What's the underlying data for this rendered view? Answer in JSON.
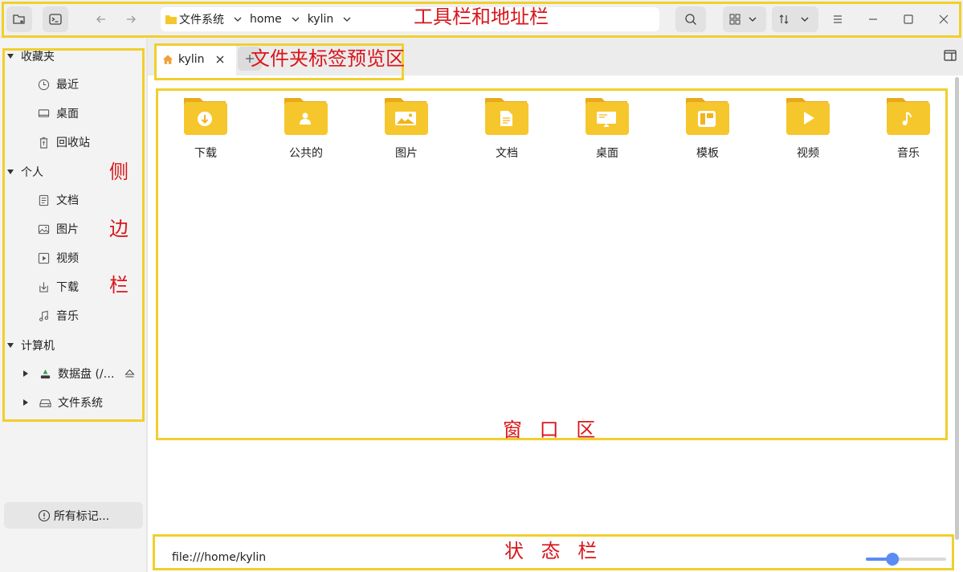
{
  "toolbar": {
    "breadcrumbs": [
      "文件系统",
      "home",
      "kylin"
    ]
  },
  "sidebar": {
    "sections": [
      {
        "label": "收藏夹",
        "items": [
          {
            "label": "最近",
            "icon": "clock-icon"
          },
          {
            "label": "桌面",
            "icon": "monitor-icon"
          },
          {
            "label": "回收站",
            "icon": "trash-icon"
          }
        ]
      },
      {
        "label": "个人",
        "items": [
          {
            "label": "文档",
            "icon": "document-icon"
          },
          {
            "label": "图片",
            "icon": "image-icon"
          },
          {
            "label": "视频",
            "icon": "video-icon"
          },
          {
            "label": "下载",
            "icon": "download-icon"
          },
          {
            "label": "音乐",
            "icon": "music-icon"
          }
        ]
      },
      {
        "label": "计算机",
        "items": [
          {
            "label": "数据盘 (/…",
            "icon": "drive-icon"
          },
          {
            "label": "文件系统",
            "icon": "hdd-icon"
          }
        ]
      }
    ],
    "tags_button": "所有标记..."
  },
  "tabs": [
    {
      "label": "kylin"
    }
  ],
  "files": [
    {
      "name": "下载",
      "icon": "download-folder-icon"
    },
    {
      "name": "公共的",
      "icon": "public-folder-icon"
    },
    {
      "name": "图片",
      "icon": "pictures-folder-icon"
    },
    {
      "name": "文档",
      "icon": "documents-folder-icon"
    },
    {
      "name": "桌面",
      "icon": "desktop-folder-icon"
    },
    {
      "name": "模板",
      "icon": "templates-folder-icon"
    },
    {
      "name": "视频",
      "icon": "videos-folder-icon"
    },
    {
      "name": "音乐",
      "icon": "music-folder-icon"
    }
  ],
  "status": {
    "path": "file:///home/kylin",
    "zoom_fraction": 0.3
  },
  "annotations": {
    "toolbar": "工具栏和地址栏",
    "tabs": "文件夹标签预览区",
    "sidebar": [
      "侧",
      "边",
      "栏"
    ],
    "window": "窗 口 区",
    "statusbar": "状 态 栏"
  },
  "colors": {
    "annotation_box": "#f1cf2e",
    "annotation_text": "#d8161b",
    "folder": "#f6c72c",
    "slider": "#5b8cf4"
  }
}
